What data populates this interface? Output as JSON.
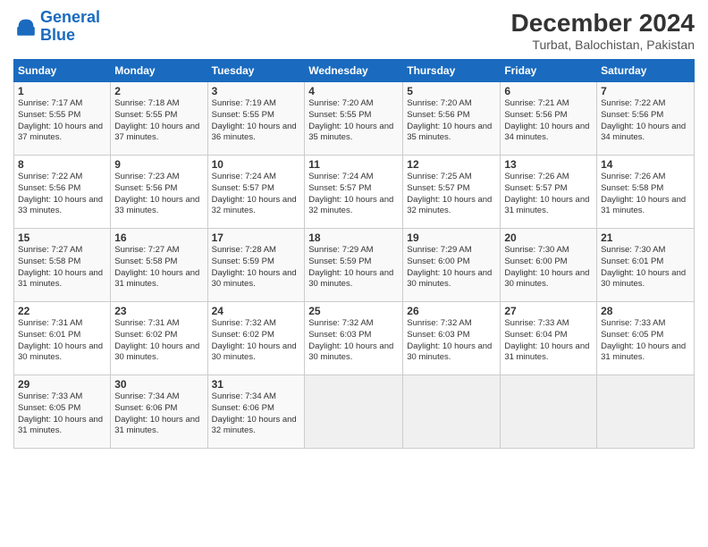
{
  "logo": {
    "line1": "General",
    "line2": "Blue"
  },
  "title": "December 2024",
  "location": "Turbat, Balochistan, Pakistan",
  "columns": [
    "Sunday",
    "Monday",
    "Tuesday",
    "Wednesday",
    "Thursday",
    "Friday",
    "Saturday"
  ],
  "weeks": [
    [
      {
        "day": "1",
        "sunrise": "7:17 AM",
        "sunset": "5:55 PM",
        "daylight": "10 hours and 37 minutes."
      },
      {
        "day": "2",
        "sunrise": "7:18 AM",
        "sunset": "5:55 PM",
        "daylight": "10 hours and 37 minutes."
      },
      {
        "day": "3",
        "sunrise": "7:19 AM",
        "sunset": "5:55 PM",
        "daylight": "10 hours and 36 minutes."
      },
      {
        "day": "4",
        "sunrise": "7:20 AM",
        "sunset": "5:55 PM",
        "daylight": "10 hours and 35 minutes."
      },
      {
        "day": "5",
        "sunrise": "7:20 AM",
        "sunset": "5:56 PM",
        "daylight": "10 hours and 35 minutes."
      },
      {
        "day": "6",
        "sunrise": "7:21 AM",
        "sunset": "5:56 PM",
        "daylight": "10 hours and 34 minutes."
      },
      {
        "day": "7",
        "sunrise": "7:22 AM",
        "sunset": "5:56 PM",
        "daylight": "10 hours and 34 minutes."
      }
    ],
    [
      {
        "day": "8",
        "sunrise": "7:22 AM",
        "sunset": "5:56 PM",
        "daylight": "10 hours and 33 minutes."
      },
      {
        "day": "9",
        "sunrise": "7:23 AM",
        "sunset": "5:56 PM",
        "daylight": "10 hours and 33 minutes."
      },
      {
        "day": "10",
        "sunrise": "7:24 AM",
        "sunset": "5:57 PM",
        "daylight": "10 hours and 32 minutes."
      },
      {
        "day": "11",
        "sunrise": "7:24 AM",
        "sunset": "5:57 PM",
        "daylight": "10 hours and 32 minutes."
      },
      {
        "day": "12",
        "sunrise": "7:25 AM",
        "sunset": "5:57 PM",
        "daylight": "10 hours and 32 minutes."
      },
      {
        "day": "13",
        "sunrise": "7:26 AM",
        "sunset": "5:57 PM",
        "daylight": "10 hours and 31 minutes."
      },
      {
        "day": "14",
        "sunrise": "7:26 AM",
        "sunset": "5:58 PM",
        "daylight": "10 hours and 31 minutes."
      }
    ],
    [
      {
        "day": "15",
        "sunrise": "7:27 AM",
        "sunset": "5:58 PM",
        "daylight": "10 hours and 31 minutes."
      },
      {
        "day": "16",
        "sunrise": "7:27 AM",
        "sunset": "5:58 PM",
        "daylight": "10 hours and 31 minutes."
      },
      {
        "day": "17",
        "sunrise": "7:28 AM",
        "sunset": "5:59 PM",
        "daylight": "10 hours and 30 minutes."
      },
      {
        "day": "18",
        "sunrise": "7:29 AM",
        "sunset": "5:59 PM",
        "daylight": "10 hours and 30 minutes."
      },
      {
        "day": "19",
        "sunrise": "7:29 AM",
        "sunset": "6:00 PM",
        "daylight": "10 hours and 30 minutes."
      },
      {
        "day": "20",
        "sunrise": "7:30 AM",
        "sunset": "6:00 PM",
        "daylight": "10 hours and 30 minutes."
      },
      {
        "day": "21",
        "sunrise": "7:30 AM",
        "sunset": "6:01 PM",
        "daylight": "10 hours and 30 minutes."
      }
    ],
    [
      {
        "day": "22",
        "sunrise": "7:31 AM",
        "sunset": "6:01 PM",
        "daylight": "10 hours and 30 minutes."
      },
      {
        "day": "23",
        "sunrise": "7:31 AM",
        "sunset": "6:02 PM",
        "daylight": "10 hours and 30 minutes."
      },
      {
        "day": "24",
        "sunrise": "7:32 AM",
        "sunset": "6:02 PM",
        "daylight": "10 hours and 30 minutes."
      },
      {
        "day": "25",
        "sunrise": "7:32 AM",
        "sunset": "6:03 PM",
        "daylight": "10 hours and 30 minutes."
      },
      {
        "day": "26",
        "sunrise": "7:32 AM",
        "sunset": "6:03 PM",
        "daylight": "10 hours and 30 minutes."
      },
      {
        "day": "27",
        "sunrise": "7:33 AM",
        "sunset": "6:04 PM",
        "daylight": "10 hours and 31 minutes."
      },
      {
        "day": "28",
        "sunrise": "7:33 AM",
        "sunset": "6:05 PM",
        "daylight": "10 hours and 31 minutes."
      }
    ],
    [
      {
        "day": "29",
        "sunrise": "7:33 AM",
        "sunset": "6:05 PM",
        "daylight": "10 hours and 31 minutes."
      },
      {
        "day": "30",
        "sunrise": "7:34 AM",
        "sunset": "6:06 PM",
        "daylight": "10 hours and 31 minutes."
      },
      {
        "day": "31",
        "sunrise": "7:34 AM",
        "sunset": "6:06 PM",
        "daylight": "10 hours and 32 minutes."
      },
      null,
      null,
      null,
      null
    ]
  ]
}
